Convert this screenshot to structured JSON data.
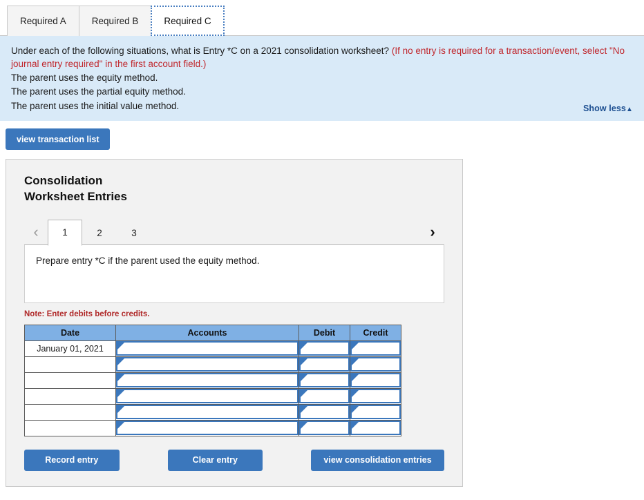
{
  "tabs": [
    {
      "label": "Required A",
      "active": false
    },
    {
      "label": "Required B",
      "active": false
    },
    {
      "label": "Required C",
      "active": true
    }
  ],
  "instructions": {
    "question_lead": "Under each of the following situations, what is Entry *C on a 2021 consolidation worksheet?",
    "question_note": "(If no entry is required for a transaction/event, select \"No journal entry required\" in the first account field.)",
    "situations": [
      "The parent uses the equity method.",
      "The parent uses the partial equity method.",
      "The parent uses the initial value method."
    ],
    "show_less_label": "Show less",
    "show_less_caret": "▲"
  },
  "transaction_button": {
    "label": "view transaction list"
  },
  "worksheet": {
    "title_line1": "Consolidation",
    "title_line2": "Worksheet Entries",
    "pager": {
      "prev_icon": "‹",
      "next_icon": "›",
      "pages": [
        "1",
        "2",
        "3"
      ],
      "active_page": "1"
    },
    "prompt": "Prepare entry *C if the parent used the equity method.",
    "note": "Note: Enter debits before credits.",
    "table": {
      "columns": [
        "Date",
        "Accounts",
        "Debit",
        "Credit"
      ],
      "rows": [
        {
          "date": "January 01, 2021",
          "accounts": "",
          "debit": "",
          "credit": ""
        },
        {
          "date": "",
          "accounts": "",
          "debit": "",
          "credit": ""
        },
        {
          "date": "",
          "accounts": "",
          "debit": "",
          "credit": ""
        },
        {
          "date": "",
          "accounts": "",
          "debit": "",
          "credit": ""
        },
        {
          "date": "",
          "accounts": "",
          "debit": "",
          "credit": ""
        },
        {
          "date": "",
          "accounts": "",
          "debit": "",
          "credit": ""
        }
      ]
    },
    "actions": {
      "record_label": "Record entry",
      "clear_label": "Clear entry",
      "view_consolidation_label": "view consolidation entries"
    }
  },
  "colors": {
    "accent_blue": "#3b77bc",
    "panel_blue": "#d9eaf8",
    "header_blue": "#7fb0e4",
    "link_blue": "#1d4f91",
    "alert_red": "#c0272d"
  }
}
